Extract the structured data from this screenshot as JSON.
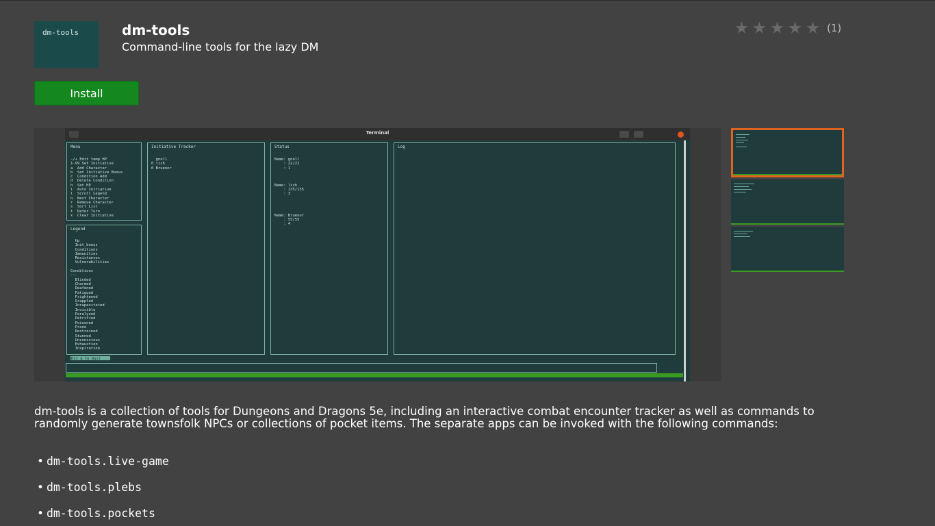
{
  "app": {
    "icon_text": "dm-tools",
    "name": "dm-tools",
    "summary": "Command-line tools for the lazy DM",
    "rating_count": "(1)",
    "rating_stars": 0,
    "install_label": "Install"
  },
  "screenshot": {
    "window_title": "Terminal",
    "panes": {
      "menu": {
        "title": "Menu",
        "lines": [
          "-/+ Edit temp HP",
          "1-99 Set Initiative",
          "a  Add Character",
          "b  Set Initiative Bonus",
          "c  Condition Add",
          "d  Delete Condition",
          "h  Set HP",
          "i  Auto Initiative",
          "l  Scroll Legend",
          "n  Next Character",
          "r  Remove Character",
          "s  Sort List",
          "t  Defer Turn",
          "x  Clear Initiative"
        ]
      },
      "legend": {
        "title": "Legend",
        "lines": [
          "  Hp",
          "  Init_bonus",
          "  Conditions",
          "  Immunities",
          "  Resistances",
          "  Vulnerabilities",
          "",
          "Conditions",
          "---",
          "  Blinded",
          "  Charmed",
          "  Deafened",
          "  Fatigued",
          "  Frightened",
          "  Grappled",
          "  Incapacitated",
          "  Invisible",
          "  Paralyzed",
          "  Petrified",
          "  Poisoned",
          "  Prone",
          "  Restrained",
          "  Stunned",
          "  Unconscious",
          "  Exhaustion",
          "  Inspiration"
        ]
      },
      "initiative": {
        "title": "Initiative Tracker",
        "lines": [
          "  gnoll",
          "0 lich",
          "0 Bruenor"
        ]
      },
      "status": {
        "title": "Status",
        "lines": [
          "Name: gnoll",
          "    : 22/22",
          "    : 1",
          "",
          "",
          "",
          "Name: lich",
          "    : 135/135",
          "    : 3",
          "",
          "",
          "",
          "",
          "Name: Bruenor",
          "    : 55/55",
          "    : 4"
        ]
      },
      "log": {
        "title": "Log"
      }
    },
    "prompt": "Hit q to Quit"
  },
  "description": "dm-tools is a collection of tools for Dungeons and Dragons 5e, including an interactive combat encounter tracker as well as commands to randomly generate townsfolk NPCs or collections of pocket items. The separate apps can be invoked with the following commands:",
  "commands": [
    "dm-tools.live-game",
    "dm-tools.plebs",
    "dm-tools.pockets"
  ],
  "colors": {
    "install": "#14871f",
    "background": "#424242",
    "selected_thumb": "#e0641f",
    "terminal_bg": "#1f3b3b"
  }
}
